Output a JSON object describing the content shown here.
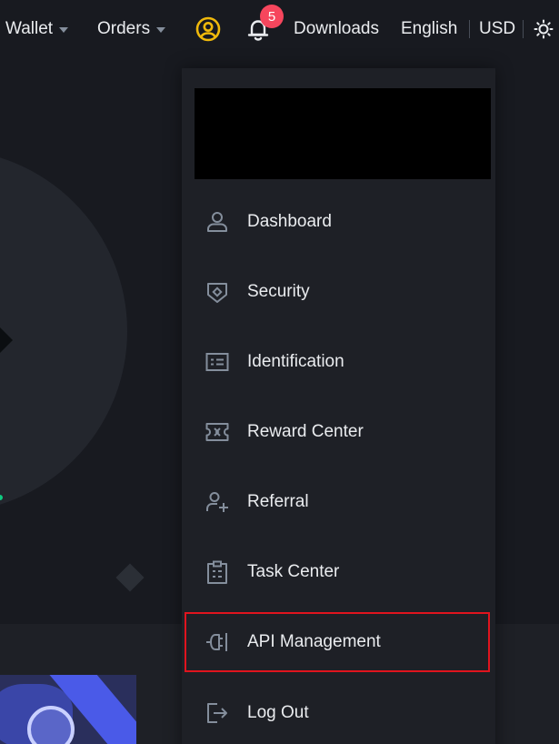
{
  "topbar": {
    "wallet_label": "Wallet",
    "orders_label": "Orders",
    "notification_count": "5",
    "downloads_label": "Downloads",
    "language_label": "English",
    "currency_label": "USD"
  },
  "colors": {
    "background": "#181a20",
    "dropdown_background": "#1e2026",
    "text_primary": "#eaecef",
    "icon_secondary": "#848e9c",
    "brand_yellow": "#f0b90b",
    "badge_red": "#f6465d",
    "highlight_red": "#e0141e"
  },
  "menu": {
    "items": [
      {
        "label": "Dashboard",
        "icon": "user-icon"
      },
      {
        "label": "Security",
        "icon": "shield-icon"
      },
      {
        "label": "Identification",
        "icon": "id-card-icon"
      },
      {
        "label": "Reward Center",
        "icon": "ticket-icon"
      },
      {
        "label": "Referral",
        "icon": "add-user-icon"
      },
      {
        "label": "Task Center",
        "icon": "clipboard-icon"
      },
      {
        "label": "API Management",
        "icon": "plug-icon"
      },
      {
        "label": "Log Out",
        "icon": "logout-icon"
      }
    ],
    "highlighted_item": "API Management"
  }
}
